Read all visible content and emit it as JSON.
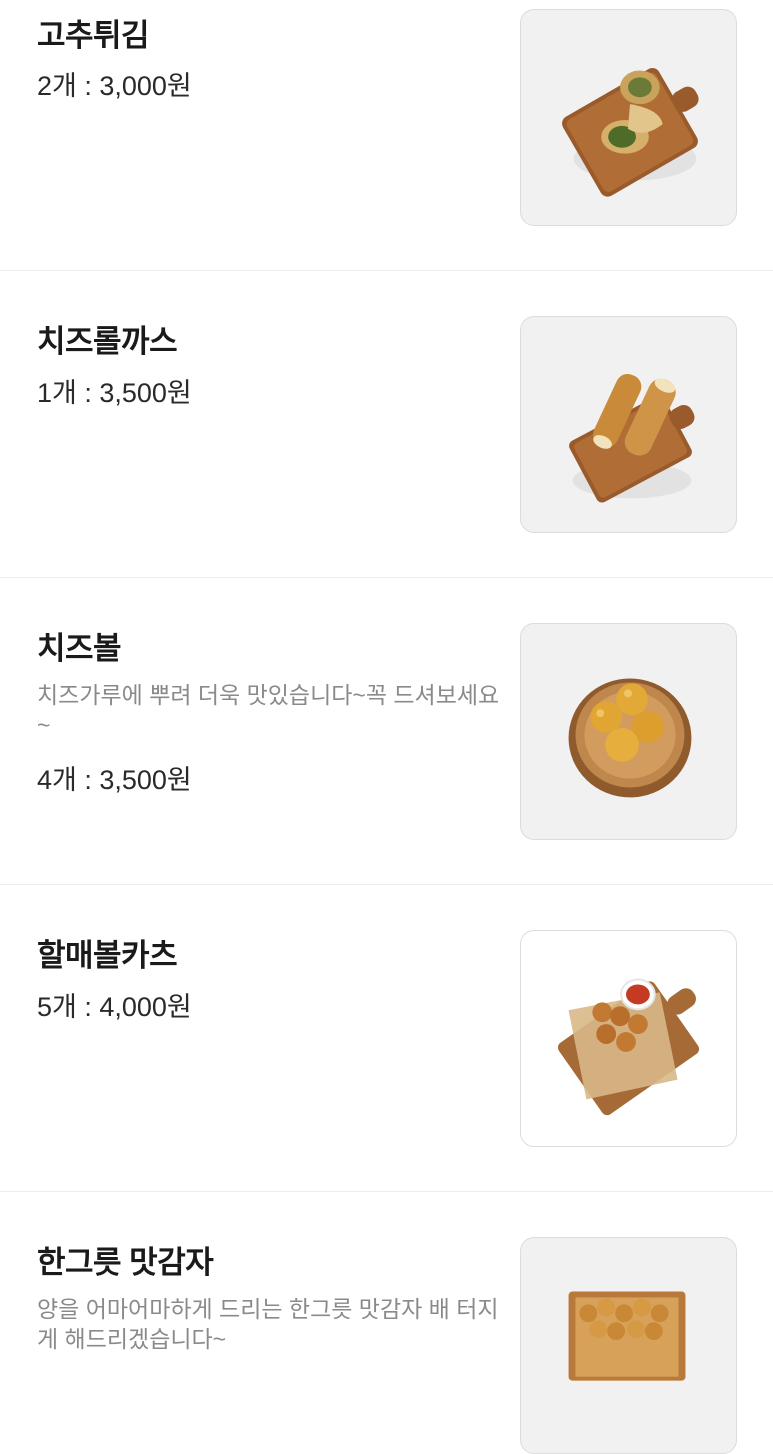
{
  "menu": {
    "items": [
      {
        "name": "고추튀김",
        "description": "",
        "price": "2개 : 3,000원",
        "image": "fried-pepper-photo"
      },
      {
        "name": "치즈롤까스",
        "description": "",
        "price": "1개 : 3,500원",
        "image": "cheese-roll-cutlet-photo"
      },
      {
        "name": "치즈볼",
        "description": "치즈가루에 뿌려 더욱 맛있습니다~꼭 드셔보세요~",
        "price": "4개 : 3,500원",
        "image": "cheese-ball-photo"
      },
      {
        "name": "할매볼카츠",
        "description": "",
        "price": "5개 : 4,000원",
        "image": "grandma-ball-katsu-photo"
      },
      {
        "name": "한그릇 맛감자",
        "description": "양을 어마어마하게 드리는 한그릇 맛감자 배 터지게 해드리겠습니다~",
        "price": "",
        "image": "fried-potato-bowl-photo"
      }
    ]
  }
}
